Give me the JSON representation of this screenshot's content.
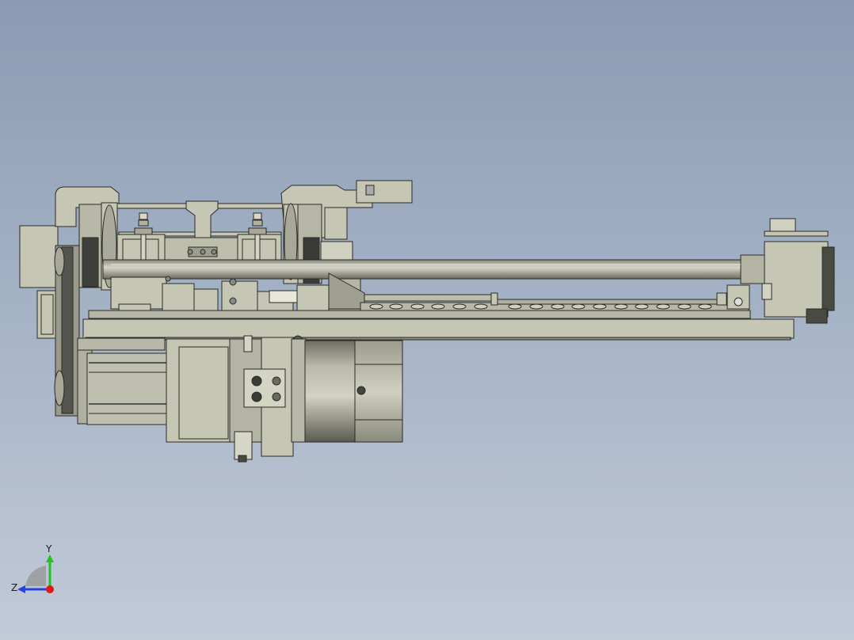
{
  "viewport": {
    "background_top": "#8a9bb3",
    "background_bottom": "#c2cad8"
  },
  "model": {
    "body_color": "#c6c6b4",
    "shadow_color": "#8f8f80",
    "dark_color": "#4a4a44",
    "edge_color": "#2a2a26"
  },
  "triad": {
    "y_label": "Y",
    "z_label": "Z",
    "y_color": "#22c322",
    "z_color": "#2244dd",
    "x_color": "#e01818"
  }
}
